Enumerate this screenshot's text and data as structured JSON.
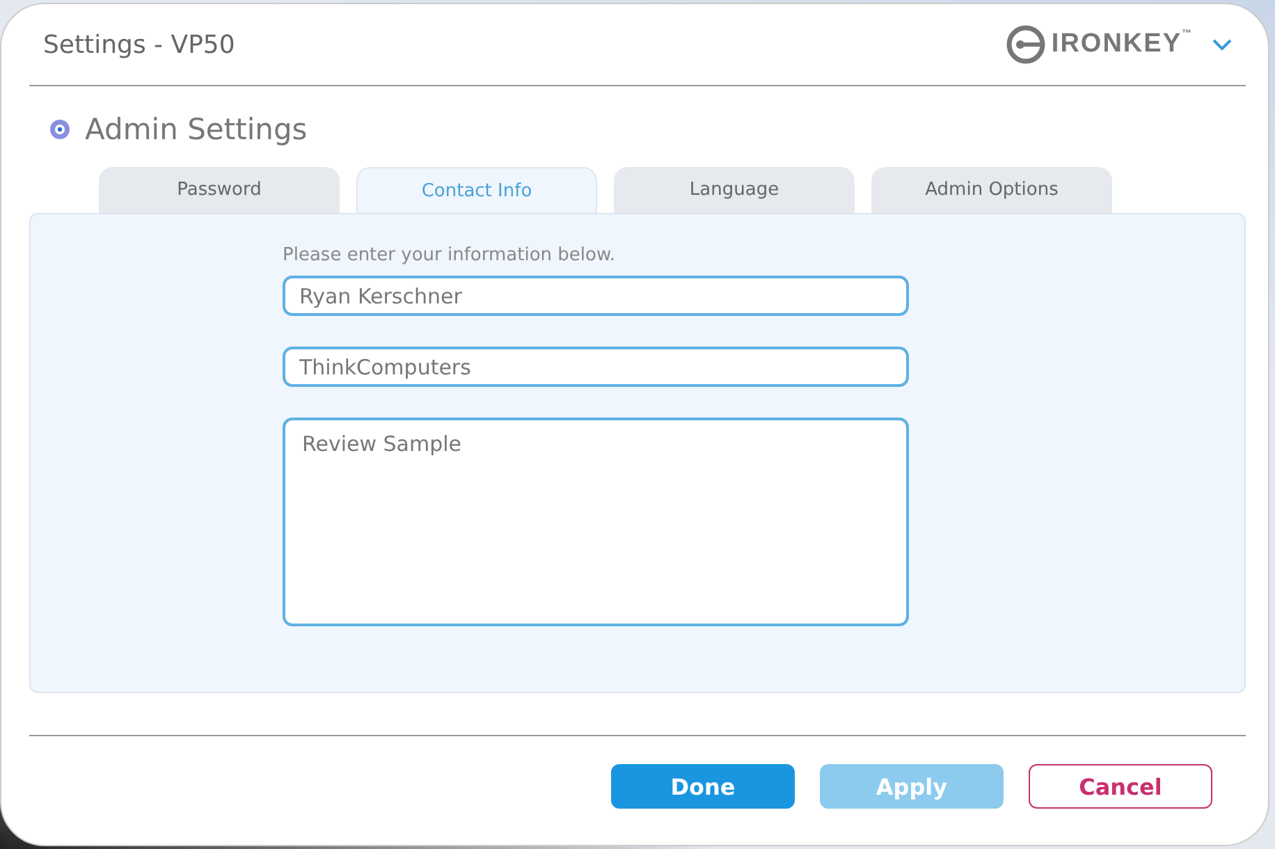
{
  "window": {
    "title": "Settings - VP50"
  },
  "logo": {
    "text": "IRONKEY",
    "trademark": "™"
  },
  "section": {
    "title": "Admin Settings"
  },
  "tabs": [
    {
      "label": "Password",
      "selected": false
    },
    {
      "label": "Contact Info",
      "selected": true
    },
    {
      "label": "Language",
      "selected": false
    },
    {
      "label": "Admin Options",
      "selected": false
    }
  ],
  "form": {
    "instruction": "Please enter your information below.",
    "fields": [
      {
        "kind": "line",
        "value": "Ryan Kerschner"
      },
      {
        "kind": "line",
        "value": "ThinkComputers"
      },
      {
        "kind": "multiline",
        "value": "Review Sample"
      }
    ]
  },
  "buttons": [
    {
      "label": "Done",
      "kind": "primary",
      "disabled": false
    },
    {
      "label": "Apply",
      "kind": "primary",
      "disabled": true
    },
    {
      "label": "Cancel",
      "kind": "outline",
      "disabled": false
    }
  ]
}
